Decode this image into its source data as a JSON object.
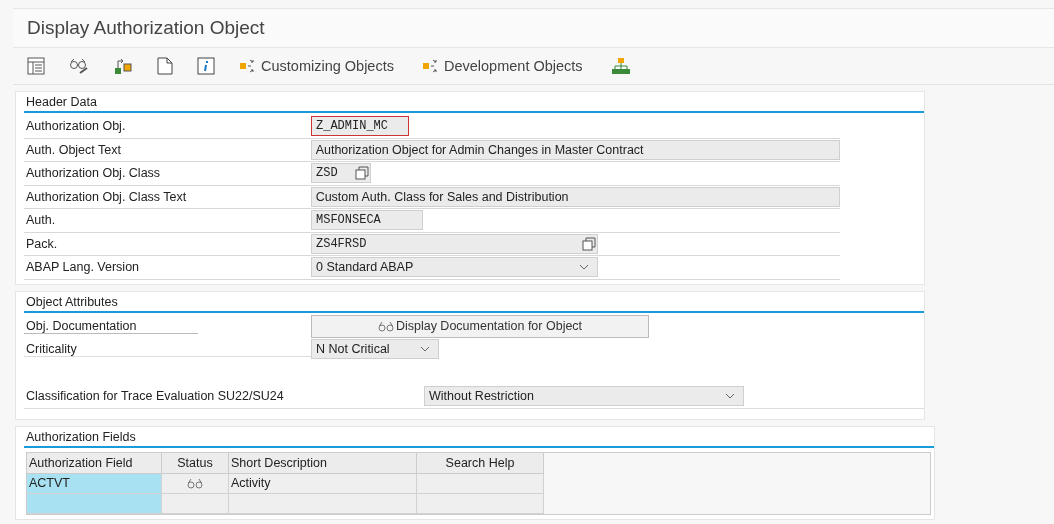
{
  "window": {
    "title": "Display Authorization Object"
  },
  "toolbar": [
    {
      "kind": "icon"
    },
    {
      "kind": "icon"
    },
    {
      "kind": "icon"
    },
    {
      "kind": "icon"
    },
    {
      "kind": "icon"
    },
    {
      "kind": "text",
      "label": "Customizing Objects"
    },
    {
      "kind": "text",
      "label": "Development Objects"
    },
    {
      "kind": "icon"
    }
  ],
  "header_data": {
    "title": "Header Data",
    "fields": [
      {
        "label": "Authorization Obj.",
        "kind": "code",
        "value": "Z_ADMIN_MC",
        "focused": true
      },
      {
        "label": "Auth. Object Text",
        "kind": "text",
        "value": "Authorization Object for Admin Changes in Master Contract",
        "focused": false
      },
      {
        "label": "Authorization Obj. Class",
        "kind": "code_help",
        "value": "ZSD",
        "focused": false
      },
      {
        "label": "Authorization Obj. Class Text",
        "kind": "text",
        "value": "Custom Auth. Class for Sales and Distribution",
        "focused": false
      },
      {
        "label": "Auth.",
        "kind": "code",
        "value": "MSFONSECA",
        "focused": false
      },
      {
        "label": "Pack.",
        "kind": "code_help",
        "value": "ZS4FRSD",
        "focused": false
      },
      {
        "label": "ABAP Lang. Version",
        "kind": "dropdown",
        "value": "0 Standard ABAP",
        "focused": false
      }
    ]
  },
  "object_attributes": {
    "title": "Object Attributes",
    "documentation": {
      "label": "Obj. Documentation",
      "button": "Display Documentation for Object"
    },
    "criticality": {
      "label": "Criticality",
      "value": "N Not Critical"
    },
    "trace_classification": {
      "label": "Classification for Trace Evaluation SU22/SU24",
      "value": "Without Restriction"
    }
  },
  "authorization_fields": {
    "title": "Authorization Fields",
    "columns": [
      "Authorization Field",
      "Status",
      "Short Description",
      "Search Help"
    ],
    "rows": [
      {
        "field": "ACTVT",
        "documented": true,
        "description": "Activity"
      }
    ]
  }
}
